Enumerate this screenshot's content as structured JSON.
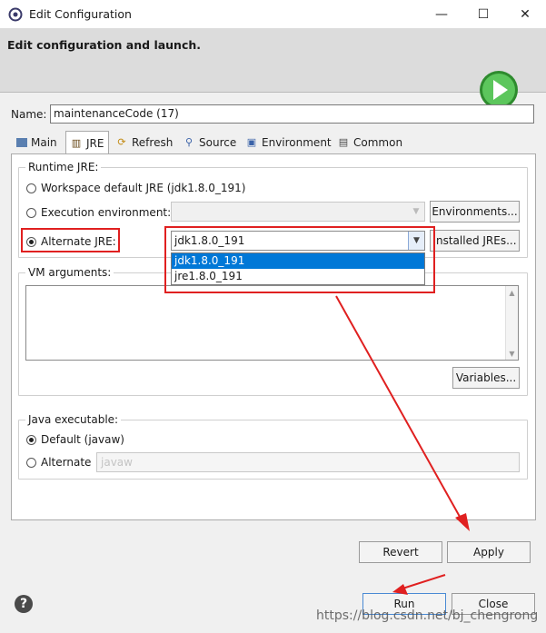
{
  "window": {
    "title": "Edit Configuration",
    "minimize": "—",
    "maximize": "☐",
    "close": "✕"
  },
  "header": {
    "subtitle": "Edit configuration and launch."
  },
  "name": {
    "label": "Name:",
    "value": "maintenanceCode (17)"
  },
  "tabs": [
    {
      "label": "Main",
      "icon": "main-tab-icon"
    },
    {
      "label": "JRE",
      "icon": "jre-tab-icon",
      "active": true
    },
    {
      "label": "Refresh",
      "icon": "refresh-icon"
    },
    {
      "label": "Source",
      "icon": "source-icon"
    },
    {
      "label": "Environment",
      "icon": "environment-icon"
    },
    {
      "label": "Common",
      "icon": "common-icon"
    }
  ],
  "runtime_jre": {
    "group_title": "Runtime JRE:",
    "workspace_default": "Workspace default JRE (jdk1.8.0_191)",
    "execution_env": "Execution environment:",
    "environments_button": "Environments...",
    "alternate_jre": "Alternate JRE:",
    "alternate_selected": "jdk1.8.0_191",
    "installed_button": "Installed JREs...",
    "options": [
      "jdk1.8.0_191",
      "jre1.8.0_191"
    ]
  },
  "vm_args": {
    "group_title": "VM arguments:",
    "variables_button": "Variables..."
  },
  "java_exec": {
    "group_title": "Java executable:",
    "default": "Default (javaw)",
    "alternate": "Alternate",
    "alternate_placeholder": "javaw"
  },
  "footer": {
    "revert": "Revert",
    "apply": "Apply",
    "run": "Run",
    "close": "Close"
  },
  "watermark": "https://blog.csdn.net/bj_chengrong",
  "colors": {
    "annotation": "#e02020",
    "selection": "#0078d7",
    "run_green": "#3fae3f"
  }
}
